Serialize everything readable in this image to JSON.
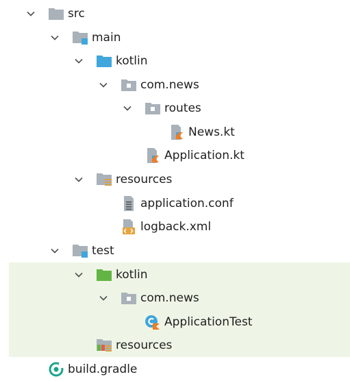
{
  "tree": {
    "items": [
      {
        "label": "src",
        "icon": "folder-icon",
        "expanded": true
      },
      {
        "label": "main",
        "icon": "source-root-folder-icon",
        "expanded": true
      },
      {
        "label": "kotlin",
        "icon": "kotlin-source-folder-icon",
        "expanded": true
      },
      {
        "label": "com.news",
        "icon": "package-folder-icon",
        "expanded": true
      },
      {
        "label": "routes",
        "icon": "package-folder-icon",
        "expanded": true
      },
      {
        "label": "News.kt",
        "icon": "kotlin-file-icon"
      },
      {
        "label": "Application.kt",
        "icon": "kotlin-file-icon"
      },
      {
        "label": "resources",
        "icon": "resources-folder-icon",
        "expanded": true
      },
      {
        "label": "application.conf",
        "icon": "text-file-icon"
      },
      {
        "label": "logback.xml",
        "icon": "xml-file-icon"
      },
      {
        "label": "test",
        "icon": "source-root-folder-icon",
        "expanded": true
      },
      {
        "label": "kotlin",
        "icon": "kotlin-test-folder-icon",
        "expanded": true
      },
      {
        "label": "com.news",
        "icon": "package-folder-icon",
        "expanded": true
      },
      {
        "label": "ApplicationTest",
        "icon": "kotlin-test-class-icon"
      },
      {
        "label": "resources",
        "icon": "test-resources-folder-icon"
      },
      {
        "label": "build.gradle",
        "icon": "gradle-file-icon"
      }
    ]
  },
  "colors": {
    "test_highlight": "#eef5e6",
    "folder_gray": "#a9b1b9",
    "source_blue": "#40a6dc",
    "test_green": "#62b543",
    "kotlin_orange": "#f37b20",
    "gradle_green": "#1ba48b"
  }
}
